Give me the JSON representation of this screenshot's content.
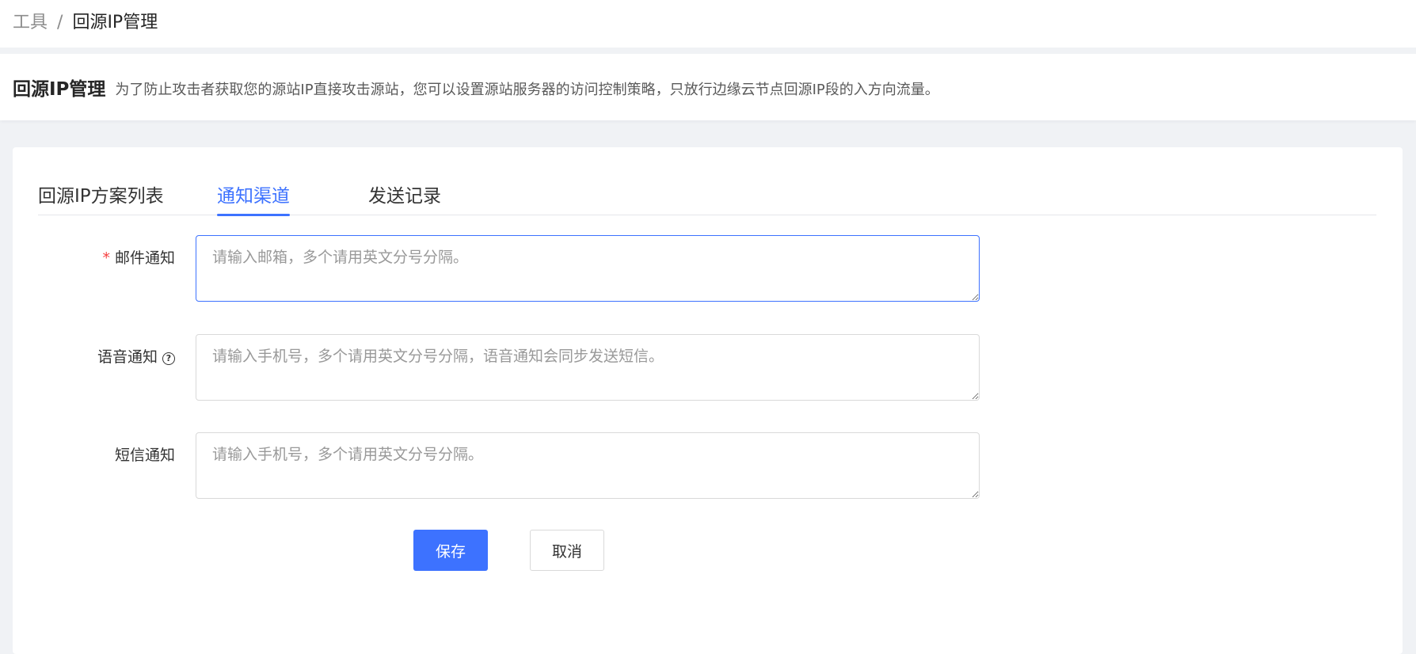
{
  "breadcrumb": {
    "parent": "工具",
    "separator": "/",
    "current": "回源IP管理"
  },
  "header": {
    "title": "回源IP管理",
    "description": "为了防止攻击者获取您的源站IP直接攻击源站，您可以设置源站服务器的访问控制策略，只放行边缘云节点回源IP段的入方向流量。"
  },
  "tabs": [
    {
      "label": "回源IP方案列表",
      "active": false
    },
    {
      "label": "通知渠道",
      "active": true
    },
    {
      "label": "发送记录",
      "active": false
    }
  ],
  "form": {
    "email": {
      "required": true,
      "required_mark": "*",
      "label": "邮件通知",
      "value": "",
      "placeholder": "请输入邮箱，多个请用英文分号分隔。"
    },
    "voice": {
      "label": "语音通知",
      "help_icon": "question-circle-icon",
      "help_glyph": "?",
      "value": "",
      "placeholder": "请输入手机号，多个请用英文分号分隔，语音通知会同步发送短信。"
    },
    "sms": {
      "label": "短信通知",
      "value": "",
      "placeholder": "请输入手机号，多个请用英文分号分隔。"
    }
  },
  "buttons": {
    "save_label": "保存",
    "cancel_label": "取消"
  },
  "colors": {
    "accent": "#3d72ff",
    "required": "#f53f3f"
  }
}
